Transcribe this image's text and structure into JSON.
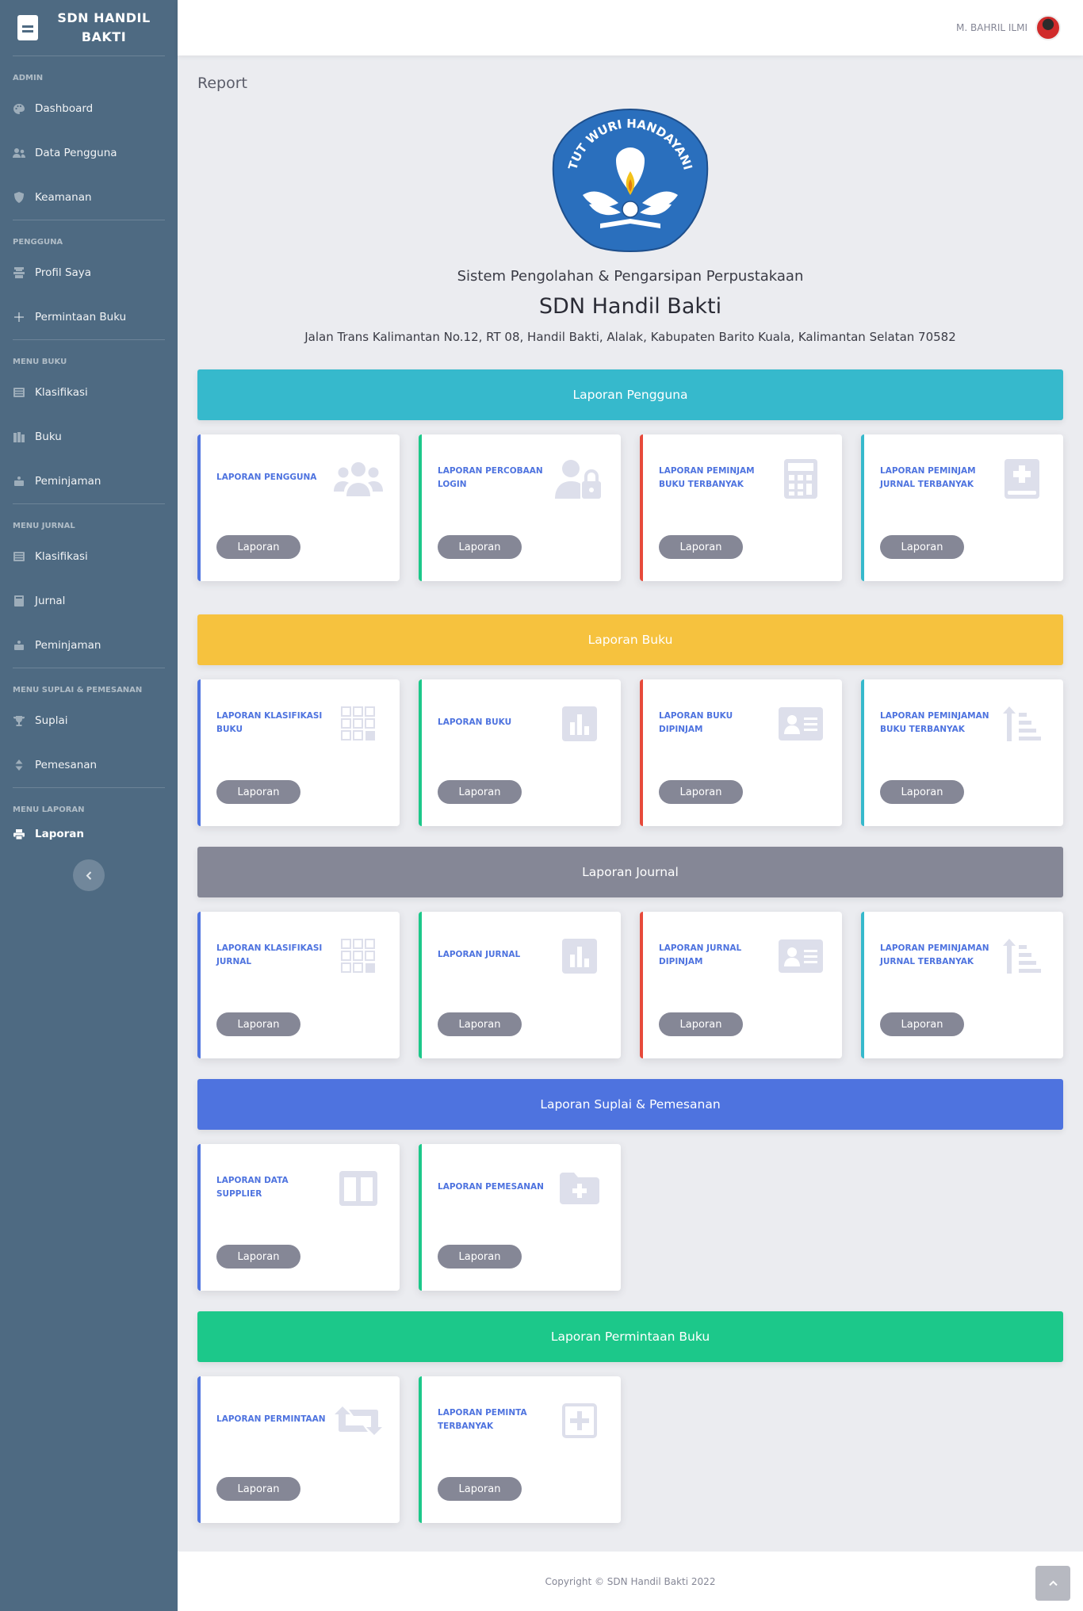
{
  "brand": {
    "title_line1": "SDN HANDIL",
    "title_line2": "BAKTI"
  },
  "sidebar": {
    "sections": [
      {
        "heading": "ADMIN",
        "items": [
          {
            "label": "Dashboard",
            "icon": "palette-icon"
          },
          {
            "label": "Data Pengguna",
            "icon": "users-icon"
          },
          {
            "label": "Keamanan",
            "icon": "shield-icon"
          }
        ]
      },
      {
        "heading": "PENGGUNA",
        "items": [
          {
            "label": "Profil Saya",
            "icon": "id-card-icon"
          },
          {
            "label": "Permintaan Buku",
            "icon": "plus-icon"
          }
        ]
      },
      {
        "heading": "MENU BUKU",
        "items": [
          {
            "label": "Klasifikasi",
            "icon": "list-icon"
          },
          {
            "label": "Buku",
            "icon": "books-icon"
          },
          {
            "label": "Peminjaman",
            "icon": "people-carry-icon"
          }
        ]
      },
      {
        "heading": "MENU JURNAL",
        "items": [
          {
            "label": "Klasifikasi",
            "icon": "list-icon"
          },
          {
            "label": "Jurnal",
            "icon": "book-icon"
          },
          {
            "label": "Peminjaman",
            "icon": "people-carry-icon"
          }
        ]
      },
      {
        "heading": "MENU SUPLAI & PEMESANAN",
        "items": [
          {
            "label": "Suplai",
            "icon": "trophy-icon"
          },
          {
            "label": "Pemesanan",
            "icon": "sort-icon"
          }
        ]
      },
      {
        "heading": "MENU LAPORAN",
        "items": [
          {
            "label": "Laporan",
            "icon": "print-icon",
            "active": true
          }
        ]
      }
    ]
  },
  "topbar": {
    "user_name": "M. BAHRIL ILMI"
  },
  "page": {
    "title": "Report",
    "subtitle": "Sistem Pengolahan & Pengarsipan Perpustakaan",
    "school": "SDN Handil Bakti",
    "address": "Jalan Trans Kalimantan No.12, RT 08, Handil Bakti, Alalak, Kabupaten Barito Kuala, Kalimantan Selatan 70582",
    "emblem_text": "TUT WURI HANDAYANI"
  },
  "sections": [
    {
      "title": "Laporan Pengguna",
      "color": "#36b9cc",
      "cards": [
        {
          "label": "LAPORAN PENGGUNA",
          "border": "primary",
          "icon": "users-icon",
          "button": "Laporan"
        },
        {
          "label": "LAPORAN PERCOBAAN LOGIN",
          "border": "success",
          "icon": "user-lock-icon",
          "button": "Laporan"
        },
        {
          "label": "LAPORAN PEMINJAM BUKU TERBANYAK",
          "border": "danger",
          "icon": "calculator-icon",
          "button": "Laporan"
        },
        {
          "label": "LAPORAN PEMINJAM JURNAL TERBANYAK",
          "border": "info",
          "icon": "book-medical-icon",
          "button": "Laporan"
        }
      ]
    },
    {
      "title": "Laporan Buku",
      "color": "#f6c23e",
      "cards": [
        {
          "label": "LAPORAN KLASIFIKASI BUKU",
          "border": "primary",
          "icon": "grid-icon",
          "button": "Laporan"
        },
        {
          "label": "LAPORAN BUKU",
          "border": "success",
          "icon": "bar-chart-icon",
          "button": "Laporan"
        },
        {
          "label": "LAPORAN BUKU DIPINJAM",
          "border": "danger",
          "icon": "id-card-icon",
          "button": "Laporan"
        },
        {
          "label": "LAPORAN PEMINJAMAN BUKU TERBANYAK",
          "border": "info",
          "icon": "sort-amount-up-icon",
          "button": "Laporan"
        }
      ]
    },
    {
      "title": "Laporan Journal",
      "color": "#858796",
      "cards": [
        {
          "label": "LAPORAN KLASIFIKASI JURNAL",
          "border": "primary",
          "icon": "grid-icon",
          "button": "Laporan"
        },
        {
          "label": "LAPORAN JURNAL",
          "border": "success",
          "icon": "bar-chart-icon",
          "button": "Laporan"
        },
        {
          "label": "LAPORAN JURNAL DIPINJAM",
          "border": "danger",
          "icon": "id-card-icon",
          "button": "Laporan"
        },
        {
          "label": "LAPORAN PEMINJAMAN JURNAL TERBANYAK",
          "border": "info",
          "icon": "sort-amount-up-icon",
          "button": "Laporan"
        }
      ]
    },
    {
      "title": "Laporan Suplai & Pemesanan",
      "color": "#4e73df",
      "cards": [
        {
          "label": "LAPORAN DATA SUPPLIER",
          "border": "primary",
          "icon": "columns-icon",
          "button": "Laporan"
        },
        {
          "label": "LAPORAN PEMESANAN",
          "border": "success",
          "icon": "folder-plus-icon",
          "button": "Laporan"
        }
      ]
    },
    {
      "title": "Laporan Permintaan Buku",
      "color": "#1cc88a",
      "cards": [
        {
          "label": "LAPORAN PERMINTAAN",
          "border": "primary",
          "icon": "retweet-icon",
          "button": "Laporan"
        },
        {
          "label": "LAPORAN PEMINTA TERBANYAK",
          "border": "success",
          "icon": "plus-square-icon",
          "button": "Laporan"
        }
      ]
    }
  ],
  "footer": {
    "copyright": "Copyright © SDN Handil Bakti 2022"
  }
}
